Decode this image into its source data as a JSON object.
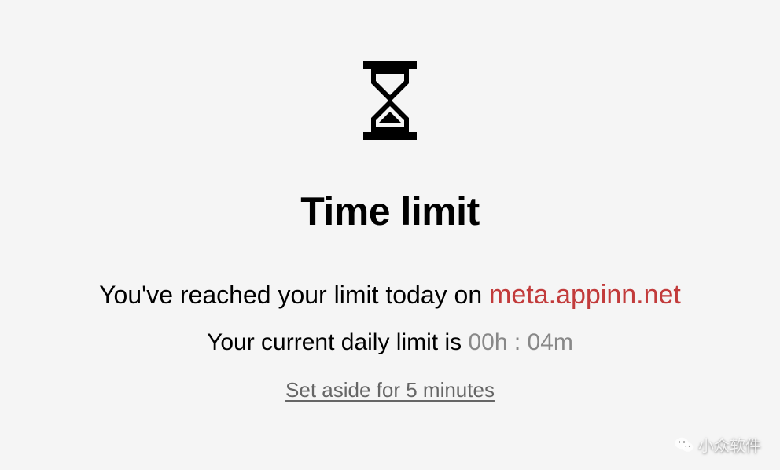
{
  "title": "Time limit",
  "message": {
    "prefix": "You've reached your limit today on ",
    "site": "meta.appinn.net"
  },
  "limit": {
    "prefix": "Your current daily limit is ",
    "time": "00h : 04m"
  },
  "set_aside_label": "Set aside for 5 minutes",
  "watermark": {
    "text": "小众软件"
  }
}
